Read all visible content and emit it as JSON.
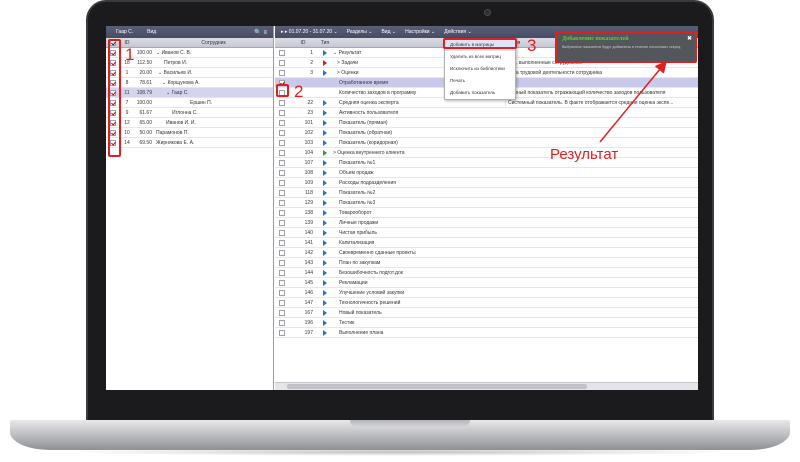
{
  "left": {
    "toolbar": {
      "user": "Гаар С.",
      "view": "Вид",
      "tools": "🔍 ≡"
    },
    "header": {
      "id": "ID",
      "employee": "Сотрудник"
    },
    "rows": [
      {
        "n": "",
        "v": "100.00",
        "name": "⌄ Иванов С. В.",
        "indent": 2,
        "checked": true
      },
      {
        "n": "18",
        "v": "112.50",
        "name": "Петров И.",
        "indent": 10,
        "checked": true
      },
      {
        "n": "1",
        "v": "20.00",
        "name": "⌄ Васильев И.",
        "indent": 4,
        "checked": true
      },
      {
        "n": "8",
        "v": "78.61",
        "name": "⌄ Корщунова А.",
        "indent": 8,
        "checked": true
      },
      {
        "n": "11",
        "v": "108.79",
        "name": "⌄ Гаар С.",
        "indent": 12,
        "checked": true,
        "sel": true
      },
      {
        "n": "7",
        "v": "100.00",
        "name": "Ершин П.",
        "indent": 36,
        "checked": true
      },
      {
        "n": "9",
        "v": "61.67",
        "name": "Иглонна С.",
        "indent": 18,
        "checked": true
      },
      {
        "n": "12",
        "v": "65.00",
        "name": "Иванов И. И.",
        "indent": 12,
        "checked": true
      },
      {
        "n": "10",
        "v": "50.00",
        "name": "Парамонов П.",
        "indent": 2,
        "checked": true
      },
      {
        "n": "14",
        "v": "69.50",
        "name": "Жирнякова Е. А.",
        "indent": 2,
        "checked": true
      }
    ]
  },
  "right": {
    "toolbar": [
      "▸ ▸ 01.07.20 - 31.07.20 ⌄",
      "Разделы ⌄",
      "Вид ⌄",
      "Настройки ⌄",
      "Действия ⌄"
    ],
    "header": {
      "id": "ID",
      "type": "Тип",
      "name": "Имя"
    },
    "rows": [
      {
        "id": "1",
        "flag": "blue",
        "name": "⌄ Результат",
        "indent": 0,
        "desc": ""
      },
      {
        "id": "2",
        "flag": "red",
        "name": "> Задачи",
        "indent": 4,
        "desc": "ачи, выполненные сотрудником"
      },
      {
        "id": "3",
        "flag": "blue",
        "name": "> Оценки",
        "indent": 4,
        "desc": "енка трудовой деятельности сотрудника"
      },
      {
        "id": "",
        "flag": "none",
        "name": "Отработанное время",
        "indent": 6,
        "desc": "",
        "sel": true,
        "checked": true
      },
      {
        "id": "",
        "flag": "none",
        "name": "Количество заходов в программу",
        "indent": 6,
        "desc": "ремный показатель отражающий количество заходов пользователя"
      },
      {
        "id": "22",
        "flag": "blue",
        "name": "Средняя оценка эксперта",
        "indent": 6,
        "desc": "Системный показатель. В факте отображается средняя оценка экспе..."
      },
      {
        "id": "23",
        "flag": "blue",
        "name": "Активность пользователя",
        "indent": 6,
        "desc": ""
      },
      {
        "id": "101",
        "flag": "blue",
        "name": "Показатель (прямая)",
        "indent": 6,
        "desc": ""
      },
      {
        "id": "102",
        "flag": "blue",
        "name": "Показатель (обратная)",
        "indent": 6,
        "desc": ""
      },
      {
        "id": "103",
        "flag": "blue",
        "name": "Показатель (коридорная)",
        "indent": 6,
        "desc": ""
      },
      {
        "id": "104",
        "flag": "green",
        "name": "> Оценка внутреннего клиента",
        "indent": 0,
        "desc": ""
      },
      {
        "id": "107",
        "flag": "blue",
        "name": "Показатель №1",
        "indent": 6,
        "desc": ""
      },
      {
        "id": "108",
        "flag": "blue",
        "name": "Объем продаж",
        "indent": 6,
        "desc": ""
      },
      {
        "id": "109",
        "flag": "blue",
        "name": "Расходы подразделения",
        "indent": 6,
        "desc": ""
      },
      {
        "id": "118",
        "flag": "blue",
        "name": "Показатель №2",
        "indent": 6,
        "desc": ""
      },
      {
        "id": "129",
        "flag": "blue",
        "name": "Показатель №3",
        "indent": 6,
        "desc": ""
      },
      {
        "id": "138",
        "flag": "blue",
        "name": "Товарооборот",
        "indent": 6,
        "desc": ""
      },
      {
        "id": "139",
        "flag": "blue",
        "name": "Личные продажи",
        "indent": 6,
        "desc": ""
      },
      {
        "id": "140",
        "flag": "blue",
        "name": "Чистая прибыль",
        "indent": 6,
        "desc": ""
      },
      {
        "id": "141",
        "flag": "blue",
        "name": "Капитализация",
        "indent": 6,
        "desc": ""
      },
      {
        "id": "142",
        "flag": "blue",
        "name": "Своевременно сданные проекты",
        "indent": 6,
        "desc": ""
      },
      {
        "id": "143",
        "flag": "blue",
        "name": "План по закупкам",
        "indent": 6,
        "desc": ""
      },
      {
        "id": "144",
        "flag": "blue",
        "name": "Безошибочность подгот.док",
        "indent": 6,
        "desc": ""
      },
      {
        "id": "145",
        "flag": "blue",
        "name": "Рекламации",
        "indent": 6,
        "desc": ""
      },
      {
        "id": "146",
        "flag": "blue",
        "name": "Улучшение условий закупки",
        "indent": 6,
        "desc": ""
      },
      {
        "id": "147",
        "flag": "blue",
        "name": "Технологичность решений",
        "indent": 6,
        "desc": ""
      },
      {
        "id": "167",
        "flag": "blue",
        "name": "Новый показатель",
        "indent": 6,
        "desc": ""
      },
      {
        "id": "196",
        "flag": "blue",
        "name": "Тестик",
        "indent": 6,
        "desc": ""
      },
      {
        "id": "197",
        "flag": "blue",
        "name": "Выполнение плана",
        "indent": 6,
        "desc": ""
      }
    ]
  },
  "menu": {
    "items": [
      "Добавить в матрицы",
      "Удалить из всех матриц",
      "Исключить из библиотеки",
      "Печать",
      "Добавить показатель"
    ]
  },
  "notification": {
    "title": "Добавление показателей",
    "body": "Выбранные показатели будут добавлены в течение нескольких секунд.",
    "close": "✖"
  },
  "annotations": {
    "n1": "1",
    "n2": "2",
    "n3": "3",
    "result": "Результат"
  },
  "colors": {
    "annotation": "#e02020",
    "toolbar": "#4f536b",
    "notice_title": "#5ad12b"
  }
}
